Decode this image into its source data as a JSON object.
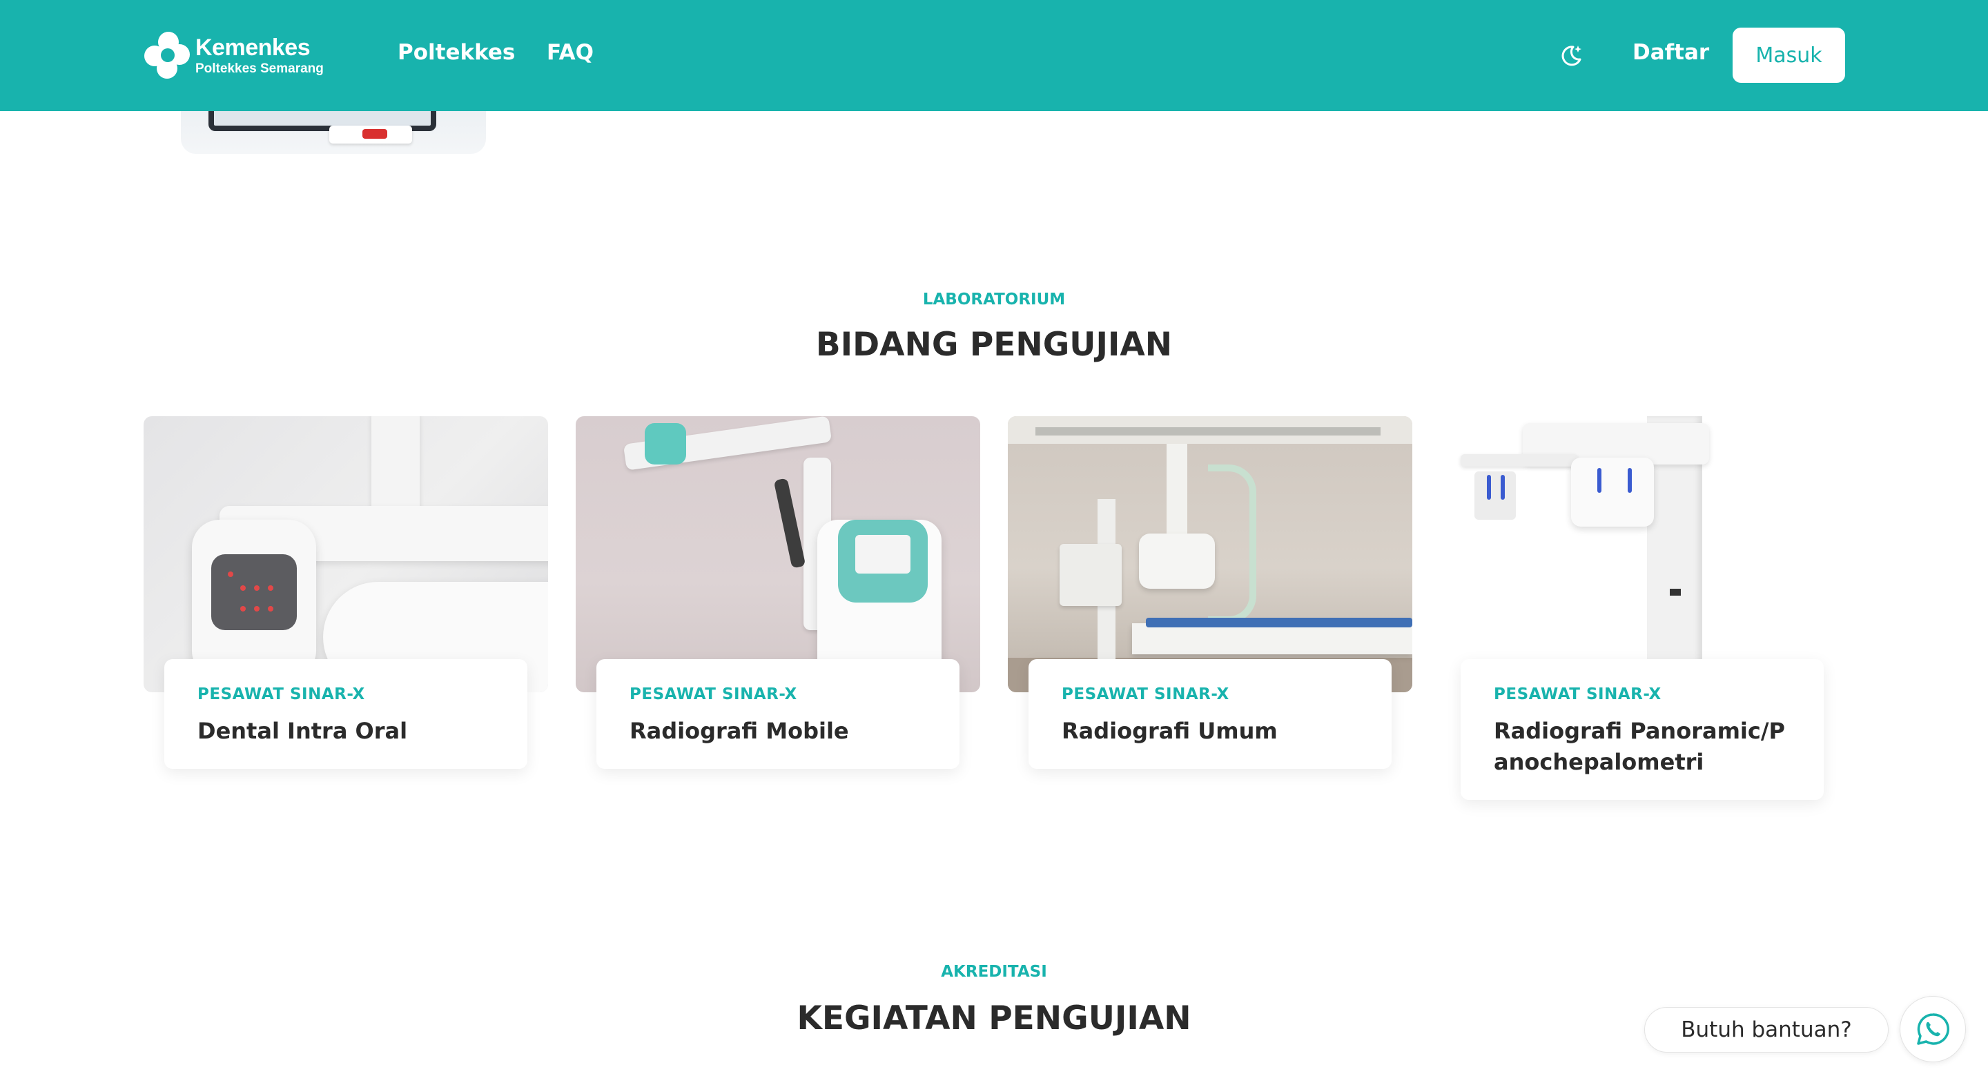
{
  "header": {
    "logo": {
      "title": "Kemenkes",
      "subtitle": "Poltekkes Semarang"
    },
    "nav": [
      {
        "label": "Poltekkes"
      },
      {
        "label": "FAQ"
      }
    ],
    "theme_icon": "moon-sparkle-icon",
    "register_label": "Daftar",
    "login_label": "Masuk",
    "colors": {
      "brand": "#18b3ad",
      "button_bg": "#ffffff"
    }
  },
  "laboratorium": {
    "eyebrow": "LABORATORIUM",
    "title": "BIDANG PENGUJIAN",
    "cards": [
      {
        "kicker": "PESAWAT SINAR-X",
        "title": "Dental Intra Oral"
      },
      {
        "kicker": "PESAWAT SINAR-X",
        "title": "Radiografi Mobile"
      },
      {
        "kicker": "PESAWAT SINAR-X",
        "title": "Radiografi Umum"
      },
      {
        "kicker": "PESAWAT SINAR-X",
        "title": "Radiografi Panoramic/Panochepalometri"
      }
    ]
  },
  "akreditasi": {
    "eyebrow": "AKREDITASI",
    "title": "KEGIATAN PENGUJIAN"
  },
  "help": {
    "label": "Butuh bantuan?",
    "icon": "whatsapp-icon"
  }
}
